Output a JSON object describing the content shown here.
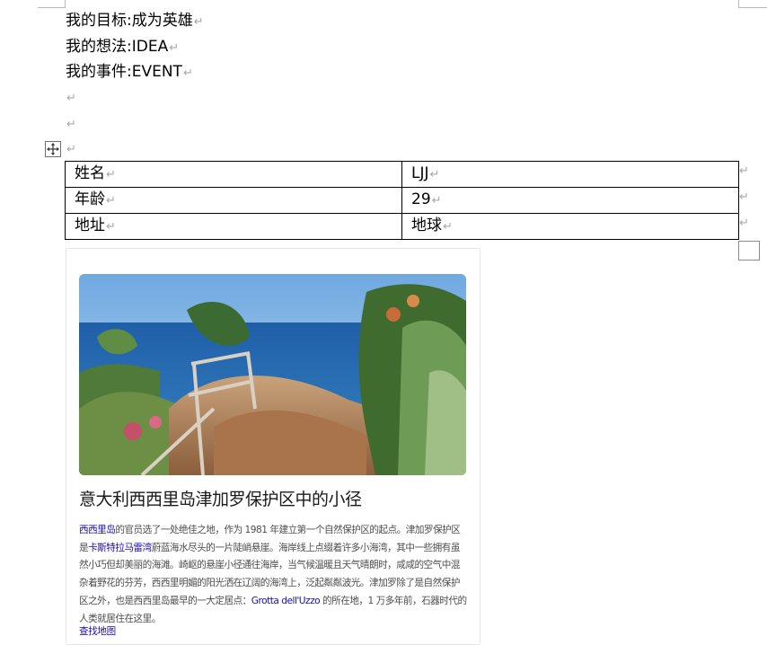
{
  "paragraphs": [
    {
      "text": "我的目标:成为英雄"
    },
    {
      "text": "我的想法:IDEA"
    },
    {
      "text": "我的事件:EVENT"
    },
    {
      "text": ""
    },
    {
      "text": ""
    },
    {
      "text": ""
    }
  ],
  "paragraph_mark": "↵",
  "table": {
    "rows": [
      {
        "label": "姓名",
        "value": "LJJ"
      },
      {
        "label": "年龄",
        "value": "29"
      },
      {
        "label": "地址",
        "value": "地球"
      }
    ]
  },
  "card": {
    "title": "意大利西西里岛津加罗保护区中的小径",
    "body": {
      "link1": "西西里岛",
      "text1": "的官员选了一处绝佳之地，作为 1981 年建立第一个自然保护区的起点。津加罗保护区是",
      "link2": "卡斯特拉马雷湾",
      "text2": "蔚蓝海水尽头的一片陡峭悬崖。海岸线上点缀着许多小海湾，其中一些拥有虽然小巧但却美丽的海滩。崎岖的悬崖小径通往海岸，当气候温暖且天气晴朗时，咸咸的空气中混杂着野花的芬芳，西西里明媚的阳光洒在辽阔的海湾上，泛起粼粼波光。津加罗除了是自然保护区之外，也是西西里岛最早的一大定居点：",
      "link3": "Grotta dell'Uzzo",
      "text3": " 的所在地，1 万多年前，石器时代的人类就居住在这里。"
    },
    "map_link": "查找地图"
  },
  "colors": {
    "link": "#1a0dab",
    "mark": "#a8a8a8",
    "sea": "#2f6fb3",
    "sky": "#9cc8ee"
  }
}
